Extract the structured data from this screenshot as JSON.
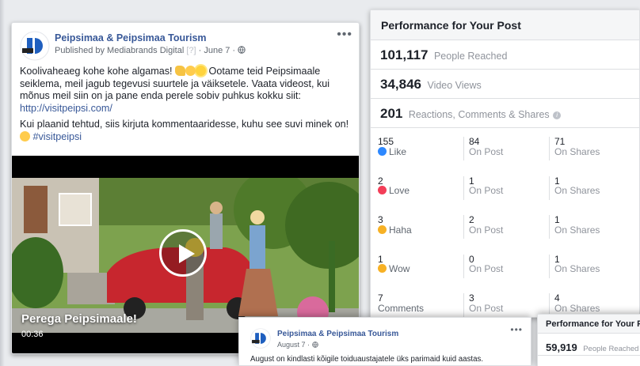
{
  "post1": {
    "page_name": "Peipsimaa & Peipsimaa Tourism",
    "published_prefix": "Published by ",
    "publisher": "Mediabrands Digital",
    "help_mark": "[?]",
    "date": "· June 7 ·",
    "more": "•••",
    "text_line1": "Koolivaheaeg kohe kohe algamas!",
    "text_line1b": "Ootame teid Peipsimaale seiklema, meil jagub tegevusi suurtele ja väiksetele. Vaata videost, kui mõnus meil siin on ja pane enda perele sobiv puhkus kokku siit:",
    "link": "http://visitpeipsi.com/",
    "text_line2": "Kui plaanid tehtud, siis kirjuta kommentaaridesse, kuhu see suvi minek on!",
    "hashtag": "#visitpeipsi",
    "video_title": "Perega Peipsimaale!",
    "video_time": "00:36"
  },
  "perf1": {
    "title": "Performance for Your Post",
    "reached_num": "101,117",
    "reached_lbl": "People Reached",
    "views_num": "34,846",
    "views_lbl": "Video Views",
    "rcs_num": "201",
    "rcs_lbl": "Reactions, Comments & Shares",
    "info": "i",
    "rows": [
      {
        "n1": "155",
        "l1": "Like",
        "n2": "84",
        "l2": "On Post",
        "n3": "71",
        "l3": "On Shares"
      },
      {
        "n1": "2",
        "l1": "Love",
        "n2": "1",
        "l2": "On Post",
        "n3": "1",
        "l3": "On Shares"
      },
      {
        "n1": "3",
        "l1": "Haha",
        "n2": "2",
        "l2": "On Post",
        "n3": "1",
        "l3": "On Shares"
      },
      {
        "n1": "1",
        "l1": "Wow",
        "n2": "0",
        "l2": "On Post",
        "n3": "1",
        "l3": "On Shares"
      },
      {
        "n1": "7",
        "l1": "Comments",
        "n2": "3",
        "l2": "On Post",
        "n3": "4",
        "l3": "On Shares"
      }
    ]
  },
  "post2": {
    "page_name": "Peipsimaa & Peipsimaa Tourism",
    "date": "August 7 ·",
    "more": "•••",
    "text": "August on kindlasti kõigile toiduaustajatele üks parimaid kuid aastas."
  },
  "perf2": {
    "title": "Performance for Your Post",
    "reached_num": "59,919",
    "reached_lbl": "People Reached"
  },
  "colors": {
    "link": "#385898",
    "like": "#2d88ff",
    "love": "#f33e58",
    "haha": "#f7b125"
  }
}
